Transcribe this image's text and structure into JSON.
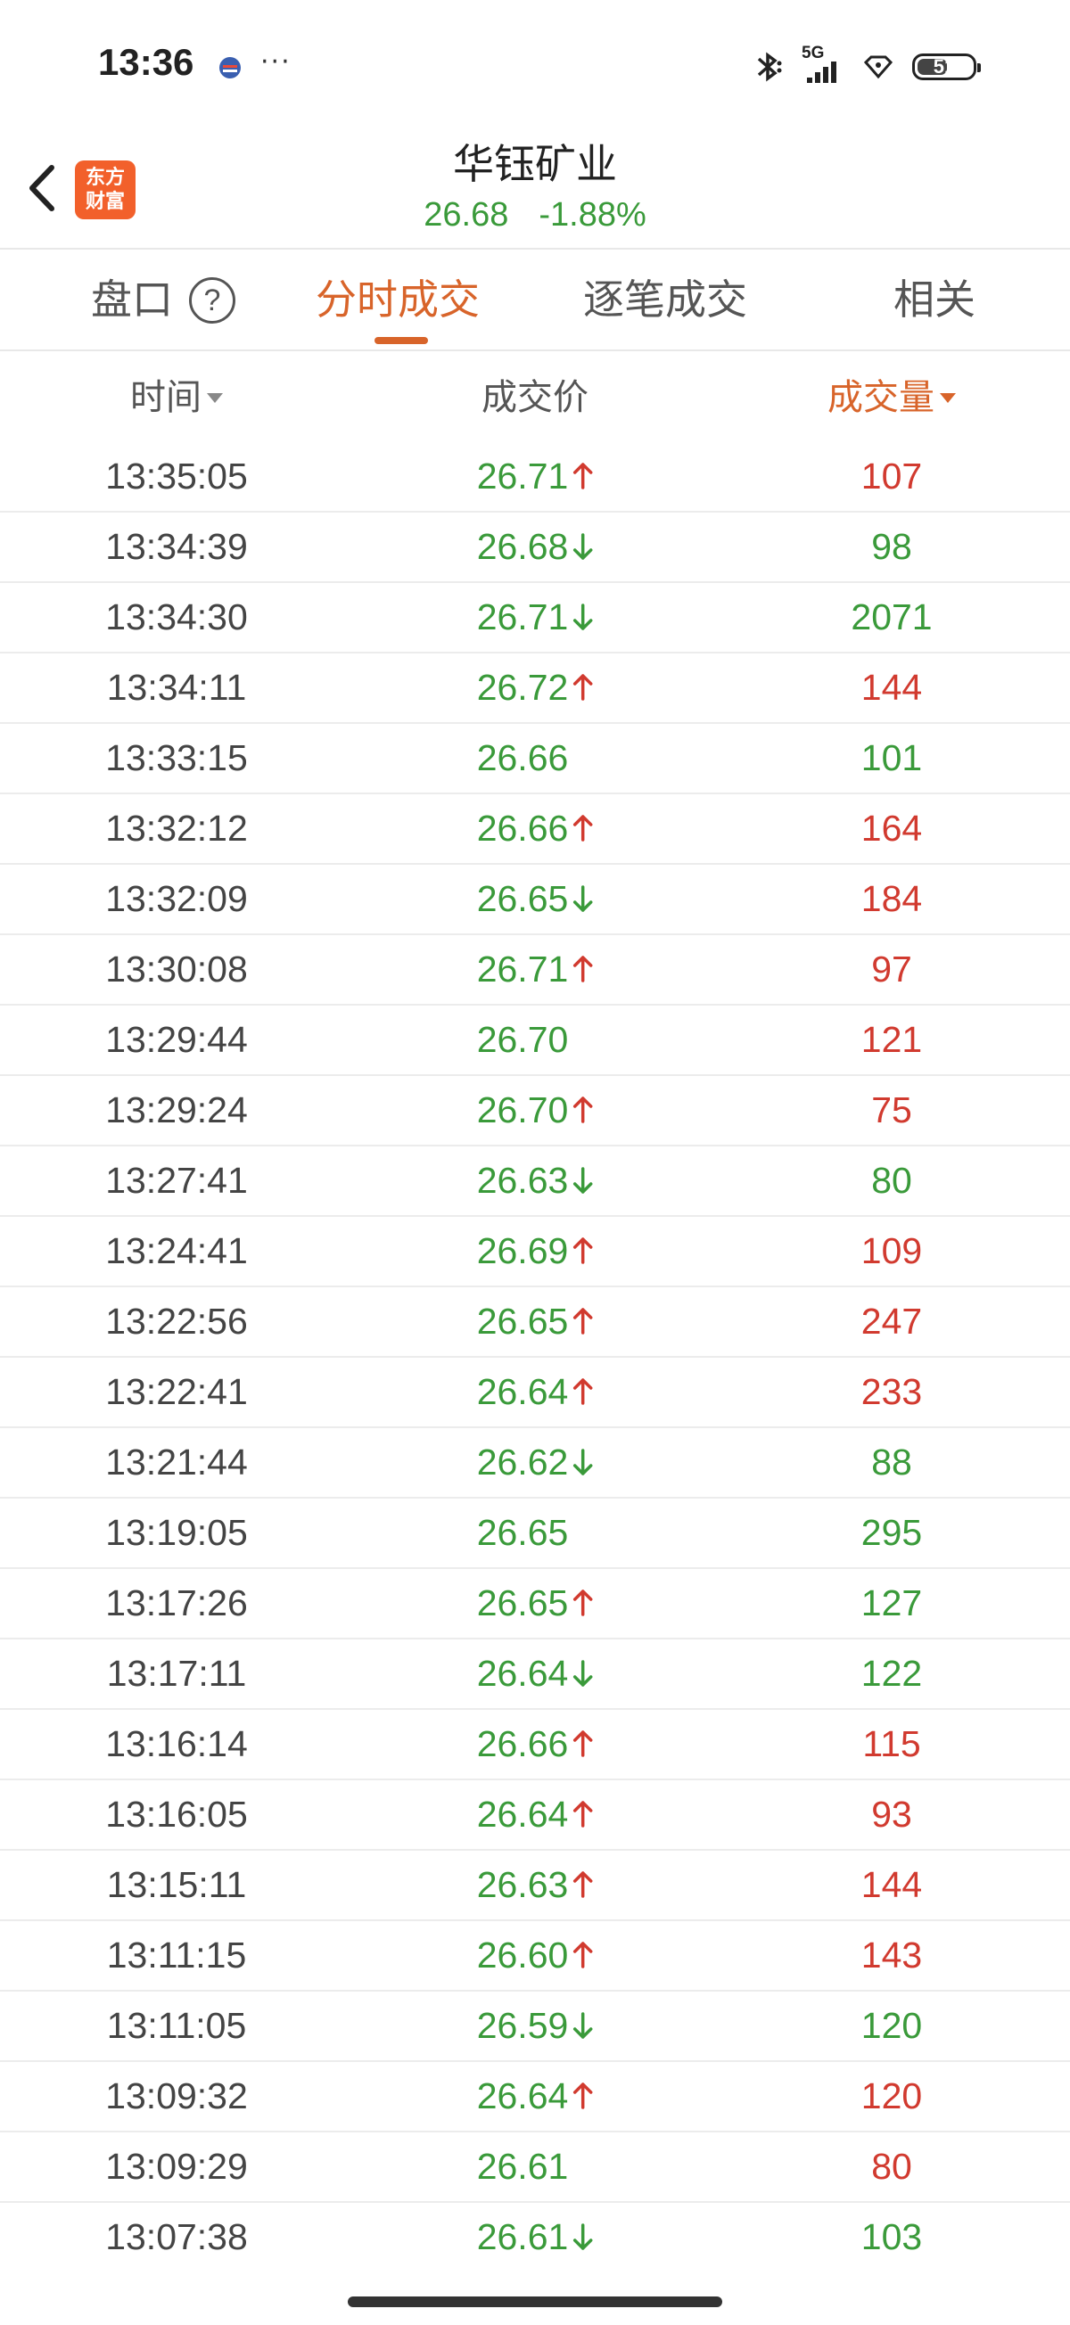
{
  "status_bar": {
    "time": "13:36",
    "more": "···",
    "network": "5G",
    "battery": "51"
  },
  "header": {
    "logo_line1": "东方",
    "logo_line2": "财富",
    "stock_name": "华钰矿业",
    "price": "26.68",
    "change_pct": "-1.88%"
  },
  "tabs": {
    "items": [
      "盘口",
      "分时成交",
      "逐笔成交",
      "相关"
    ],
    "active": "分时成交",
    "help": "?"
  },
  "columns": {
    "time": "时间",
    "price": "成交价",
    "volume": "成交量"
  },
  "colors": {
    "up": "#d13a2f",
    "down": "#3a9a3a",
    "accent": "#d8642a"
  },
  "trades": [
    {
      "time": "13:35:05",
      "price": "26.71",
      "dir": "up",
      "vol": "107",
      "vol_dir": "up"
    },
    {
      "time": "13:34:39",
      "price": "26.68",
      "dir": "down",
      "vol": "98",
      "vol_dir": "down"
    },
    {
      "time": "13:34:30",
      "price": "26.71",
      "dir": "down",
      "vol": "2071",
      "vol_dir": "down"
    },
    {
      "time": "13:34:11",
      "price": "26.72",
      "dir": "up",
      "vol": "144",
      "vol_dir": "up"
    },
    {
      "time": "13:33:15",
      "price": "26.66",
      "dir": "flat",
      "vol": "101",
      "vol_dir": "down"
    },
    {
      "time": "13:32:12",
      "price": "26.66",
      "dir": "up",
      "vol": "164",
      "vol_dir": "up"
    },
    {
      "time": "13:32:09",
      "price": "26.65",
      "dir": "down",
      "vol": "184",
      "vol_dir": "up"
    },
    {
      "time": "13:30:08",
      "price": "26.71",
      "dir": "up",
      "vol": "97",
      "vol_dir": "up"
    },
    {
      "time": "13:29:44",
      "price": "26.70",
      "dir": "flat",
      "vol": "121",
      "vol_dir": "up"
    },
    {
      "time": "13:29:24",
      "price": "26.70",
      "dir": "up",
      "vol": "75",
      "vol_dir": "up"
    },
    {
      "time": "13:27:41",
      "price": "26.63",
      "dir": "down",
      "vol": "80",
      "vol_dir": "down"
    },
    {
      "time": "13:24:41",
      "price": "26.69",
      "dir": "up",
      "vol": "109",
      "vol_dir": "up"
    },
    {
      "time": "13:22:56",
      "price": "26.65",
      "dir": "up",
      "vol": "247",
      "vol_dir": "up"
    },
    {
      "time": "13:22:41",
      "price": "26.64",
      "dir": "up",
      "vol": "233",
      "vol_dir": "up"
    },
    {
      "time": "13:21:44",
      "price": "26.62",
      "dir": "down",
      "vol": "88",
      "vol_dir": "down"
    },
    {
      "time": "13:19:05",
      "price": "26.65",
      "dir": "flat",
      "vol": "295",
      "vol_dir": "down"
    },
    {
      "time": "13:17:26",
      "price": "26.65",
      "dir": "up",
      "vol": "127",
      "vol_dir": "down"
    },
    {
      "time": "13:17:11",
      "price": "26.64",
      "dir": "down",
      "vol": "122",
      "vol_dir": "down"
    },
    {
      "time": "13:16:14",
      "price": "26.66",
      "dir": "up",
      "vol": "115",
      "vol_dir": "up"
    },
    {
      "time": "13:16:05",
      "price": "26.64",
      "dir": "up",
      "vol": "93",
      "vol_dir": "up"
    },
    {
      "time": "13:15:11",
      "price": "26.63",
      "dir": "up",
      "vol": "144",
      "vol_dir": "up"
    },
    {
      "time": "13:11:15",
      "price": "26.60",
      "dir": "up",
      "vol": "143",
      "vol_dir": "up"
    },
    {
      "time": "13:11:05",
      "price": "26.59",
      "dir": "down",
      "vol": "120",
      "vol_dir": "down"
    },
    {
      "time": "13:09:32",
      "price": "26.64",
      "dir": "up",
      "vol": "120",
      "vol_dir": "up"
    },
    {
      "time": "13:09:29",
      "price": "26.61",
      "dir": "flat",
      "vol": "80",
      "vol_dir": "up"
    },
    {
      "time": "13:07:38",
      "price": "26.61",
      "dir": "down",
      "vol": "103",
      "vol_dir": "down"
    }
  ]
}
